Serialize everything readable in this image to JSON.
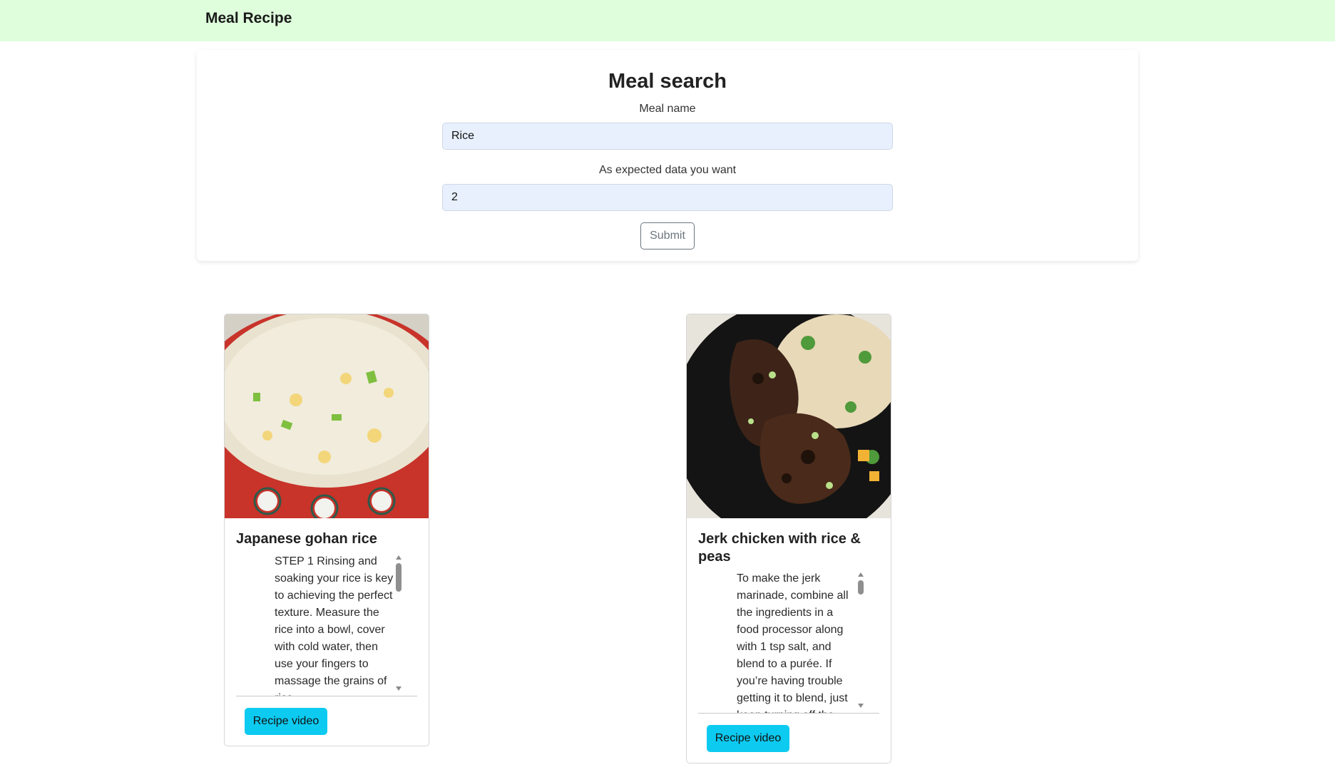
{
  "navbar": {
    "brand": "Meal Recipe"
  },
  "search": {
    "title": "Meal search",
    "meal_name_label": "Meal name",
    "meal_name_value": "Rice",
    "expected_label": "As expected data you want",
    "expected_value": "2",
    "submit_label": "Submit"
  },
  "meals": [
    {
      "title": "Japanese gohan rice",
      "instructions": "STEP 1 Rinsing and soaking your rice is key to achieving the perfect texture. Measure the rice into a bowl, cover with cold water, then use your fingers to massage the grains of rice",
      "button_label": "Recipe video"
    },
    {
      "title": "Jerk chicken with rice & peas",
      "instructions": "To make the jerk marinade, combine all the ingredients in a food processor along with 1 tsp salt, and blend to a purée. If you’re having trouble getting it to blend, just keep turning off the",
      "button_label": "Recipe video"
    }
  ],
  "colors": {
    "navbar_bg": "#dfffdc",
    "input_bg": "#e8f0fe",
    "video_button": "#0dcaf0"
  }
}
